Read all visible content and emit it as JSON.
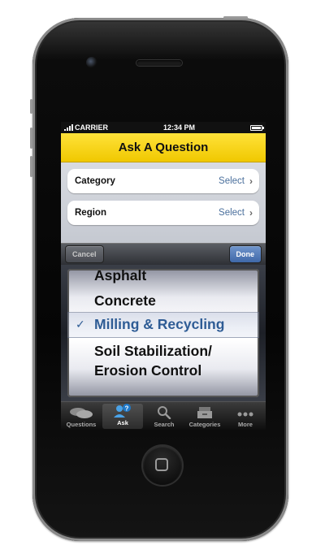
{
  "status_bar": {
    "carrier": "CARRIER",
    "time": "12:34 PM"
  },
  "title": "Ask A Question",
  "form": {
    "rows": [
      {
        "label": "Category",
        "value": "Select"
      },
      {
        "label": "Region",
        "value": "Select"
      }
    ]
  },
  "toolbar": {
    "cancel_label": "Cancel",
    "done_label": "Done"
  },
  "picker": {
    "options": [
      "Asphalt",
      "Concrete",
      "Milling & Recycling",
      "Soil Stabilization/",
      "Erosion Control"
    ],
    "selected": "Milling & Recycling",
    "check_glyph": "✓"
  },
  "tabbar": {
    "tabs": [
      {
        "label": "Questions",
        "icon": "speech-bubbles-icon"
      },
      {
        "label": "Ask",
        "icon": "ask-person-icon",
        "active": true
      },
      {
        "label": "Search",
        "icon": "magnifier-icon"
      },
      {
        "label": "Categories",
        "icon": "tray-icon"
      },
      {
        "label": "More",
        "icon": "ellipsis-icon"
      }
    ]
  },
  "colors": {
    "title_bar": "#f5d21a",
    "selected_text": "#2e5c95",
    "select_text": "#4a6f9c",
    "done_button": "#4a73b3"
  }
}
